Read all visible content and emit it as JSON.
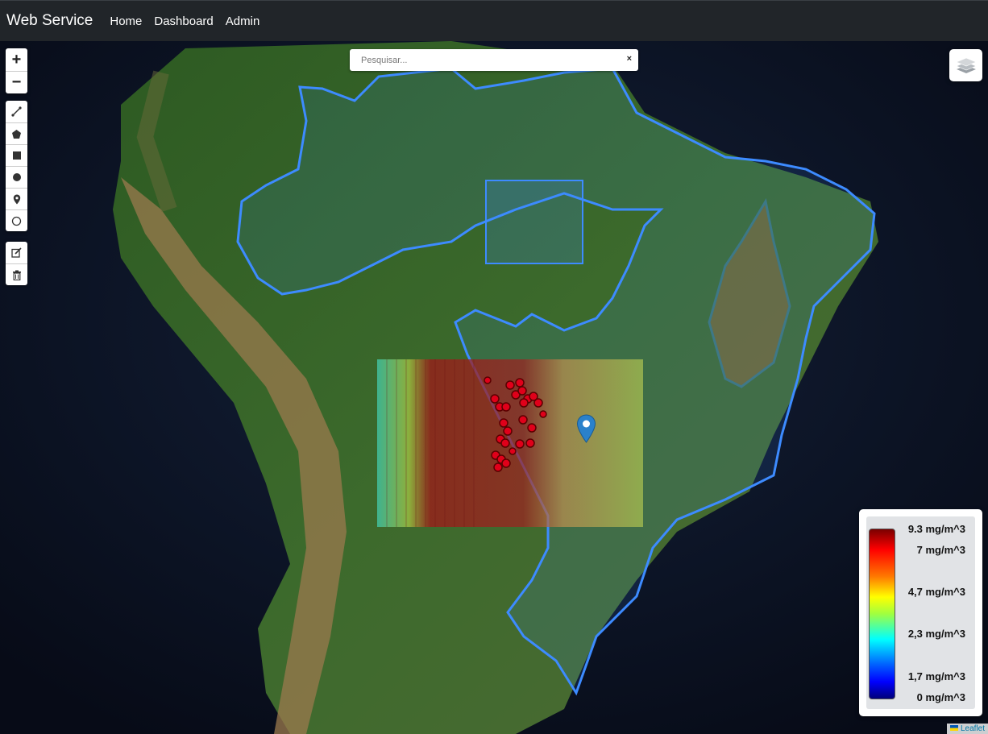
{
  "navbar": {
    "brand": "Web Service",
    "links": [
      "Home",
      "Dashboard",
      "Admin"
    ]
  },
  "search": {
    "placeholder": "Pesquisar...",
    "clear_label": "×"
  },
  "map_controls": {
    "zoom_in": "+",
    "zoom_out": "−",
    "draw_tools": [
      "polyline-icon",
      "polygon-icon",
      "rectangle-icon",
      "circle-icon",
      "marker-icon",
      "circlemarker-icon"
    ],
    "edit_tools": [
      "edit-icon",
      "trash-icon"
    ]
  },
  "legend": {
    "labels": [
      "9.3 mg/m^3",
      "7 mg/m^3",
      "4,7 mg/m^3",
      "2,3 mg/m^3",
      "1,7 mg/m^3",
      "0 mg/m^3"
    ],
    "colors": [
      "#7a0000",
      "#ff0000",
      "#ffff00",
      "#00ffff",
      "#0000ff",
      "#00007a"
    ]
  },
  "attribution": "Leaflet",
  "colors": {
    "boundary": "#3d8bff",
    "fire_point": "#e0001a",
    "navbar": "#212529"
  }
}
